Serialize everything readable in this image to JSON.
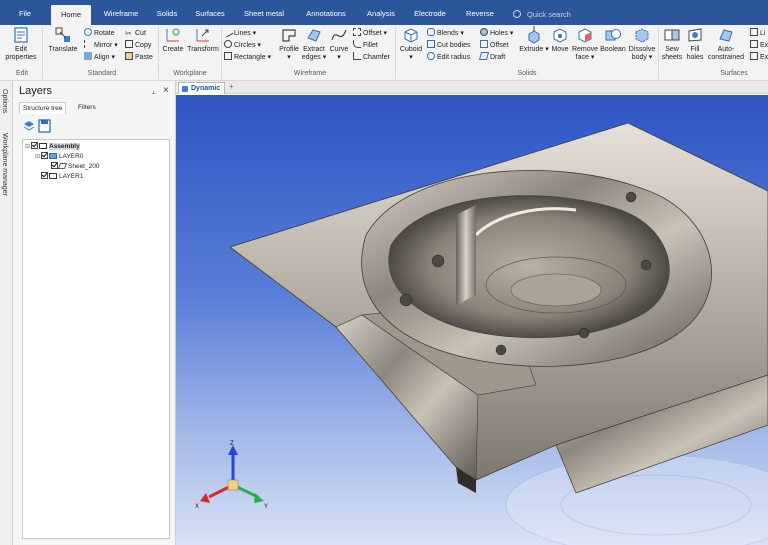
{
  "menu": {
    "tabs": [
      {
        "label": "File"
      },
      {
        "label": "Home"
      },
      {
        "label": "Wireframe"
      },
      {
        "label": "Solids"
      },
      {
        "label": "Surfaces"
      },
      {
        "label": "Sheet metal"
      },
      {
        "label": "Annotations"
      },
      {
        "label": "Analysis"
      },
      {
        "label": "Electrode"
      },
      {
        "label": "Reverse"
      }
    ],
    "active_tab": "Home",
    "search_placeholder": "Quick search"
  },
  "ribbon": {
    "edit": {
      "label": "Edit",
      "edit_properties": "Edit",
      "edit_properties_2": "properties"
    },
    "standard": {
      "label": "Standard",
      "translate": "Translate",
      "rotate": "Rotate",
      "mirror": "Mirror",
      "align": "Align",
      "cut": "Cut",
      "copy": "Copy",
      "paste": "Paste"
    },
    "workplane": {
      "label": "Workplane",
      "create": "Create",
      "transform": "Transform"
    },
    "wireframe": {
      "label": "Wireframe",
      "lines": "Lines",
      "circles": "Circles",
      "rectangle": "Rectangle",
      "profile": "Profile",
      "extract": "Extract",
      "extract_2": "edges",
      "curve": "Curve",
      "offset": "Offset",
      "fillet": "Fillet",
      "chamfer": "Chamfer"
    },
    "solids": {
      "label": "Solids",
      "cuboid": "Cuboid",
      "blends": "Blends",
      "cut_bodies": "Cut bodies",
      "edit_radius": "Edit radius",
      "holes": "Holes",
      "offset": "Offset",
      "draft": "Draft",
      "extrude": "Extrude",
      "move": "Move",
      "remove": "Remove",
      "remove_2": "face",
      "boolean": "Boolean",
      "dissolve": "Dissolve",
      "dissolve_2": "body"
    },
    "surfaces": {
      "label": "Surfaces",
      "sew": "Sew",
      "sew_2": "sheets",
      "fill": "Fill",
      "fill_2": "holes",
      "auto": "Auto-",
      "auto_2": "constrained",
      "li": "Li",
      "ex": "Ex",
      "ex2": "Ex"
    }
  },
  "side_tabs": [
    "Options",
    "Workplane manager"
  ],
  "layers_panel": {
    "title": "Layers",
    "tabs": [
      "Structure tree",
      "Filters"
    ],
    "tree": [
      {
        "label": "Assembly",
        "checked": true
      },
      {
        "label": "LAYER0",
        "checked": true
      },
      {
        "label": "Sheet_200",
        "checked": true
      },
      {
        "label": "LAYER1",
        "checked": true
      }
    ]
  },
  "document": {
    "tab_label": "Dynamic",
    "add_tab": "+"
  },
  "axes": {
    "x": "X",
    "y": "Y",
    "z": "Z"
  },
  "colors": {
    "menu_bar": "#2b579a",
    "ribbon": "#f3f3f3",
    "viewport_top": "#2d55c4",
    "viewport_bottom": "#d9e2f6"
  }
}
